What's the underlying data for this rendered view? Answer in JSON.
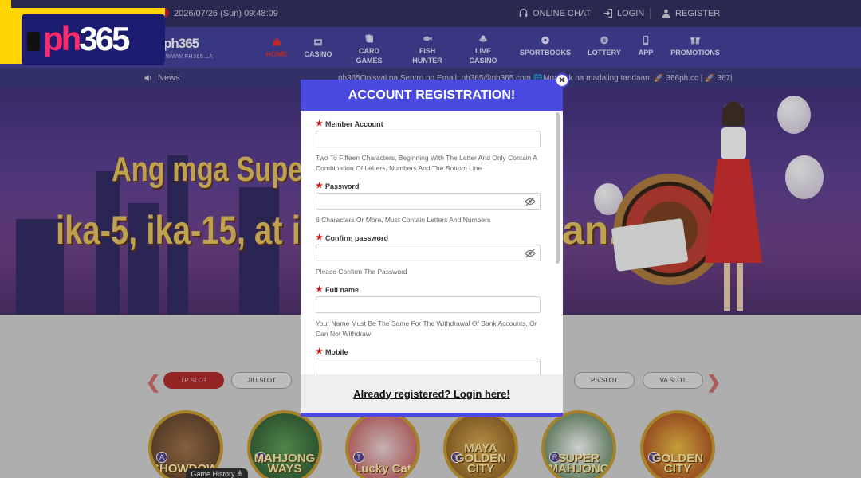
{
  "topbar": {
    "datetime": "2026/07/26 (Sun) 09:48:09",
    "online_chat": "ONLINE CHAT",
    "login": "LOGIN",
    "register": "REGISTER"
  },
  "brand": {
    "logo_text_a": "ph",
    "logo_text_b": "365",
    "small_logo": "ph365",
    "site_url": "WWW.PH365.LA"
  },
  "nav": {
    "items": [
      {
        "label": "HOME",
        "icon": "home-icon",
        "active": true
      },
      {
        "label": "CASINO",
        "icon": "casino-icon"
      },
      {
        "label": "CARD GAMES",
        "icon": "cards-icon"
      },
      {
        "label": "FISH HUNTER",
        "icon": "fish-icon"
      },
      {
        "label": "LIVE CASINO",
        "icon": "live-casino-icon"
      },
      {
        "label": "SPORTBOOKS",
        "icon": "soccer-ball-icon"
      },
      {
        "label": "LOTTERY",
        "icon": "lottery-ball-icon"
      },
      {
        "label": "APP",
        "icon": "phone-icon"
      },
      {
        "label": "PROMOTIONS",
        "icon": "gift-icon"
      }
    ]
  },
  "news": {
    "label": "News",
    "ticker": "ph365Opisyal na Sentro ng Email: ph365@ph365.com 🌐Mga link na madaling tandaan: 🚀 366ph.cc | 🚀 367ị"
  },
  "banner": {
    "line1": "Ang mga Super",
    "line2": "ika-5, ika-15, at ik",
    "line2_end": "an."
  },
  "modal": {
    "title": "ACCOUNT REGISTRATION!",
    "close": "×",
    "fields": [
      {
        "label": "Member Account",
        "hint": "Two To Fifteen Characters, Beginning With The Letter And Only Contain A Combination Of Letters, Numbers And The Bottom Line",
        "value": "",
        "has_eye": false
      },
      {
        "label": "Password",
        "hint": "6 Characters Or More, Must Contain Letters And Numbers",
        "value": "",
        "has_eye": true
      },
      {
        "label": "Confirm password",
        "hint": "Please Confirm The Password",
        "value": "",
        "has_eye": true
      },
      {
        "label": "Full name",
        "hint": "Your Name Must Be The Same For The Withdrawal Of Bank Accounts, Or Can Not Withdraw",
        "value": "",
        "has_eye": false
      },
      {
        "label": "Mobile",
        "hint": "",
        "value": "",
        "has_eye": false
      }
    ],
    "login_link": "Already registered? Login here!"
  },
  "slot_tabs": [
    "TP SLOT",
    "JILI SLOT",
    "PS SLOT",
    "VA SLOT"
  ],
  "games": [
    {
      "name": "SHOWDOWN",
      "badge": "A"
    },
    {
      "name": "MAHJONG WAYS",
      "badge": "A"
    },
    {
      "name": "Lucky Cat",
      "badge": "T"
    },
    {
      "name": "MAYA GOLDEN CITY",
      "badge": "Y"
    },
    {
      "name": "SUPER MAHJONG",
      "badge": "R"
    },
    {
      "name": "GOLDEN CITY",
      "badge": "Y"
    }
  ],
  "game_history": "Game History ≜",
  "colors": {
    "nav_bg": "#3d3d9b",
    "modal_accent": "#4a4ae0",
    "logo_yellow": "#ffd400",
    "logo_pink": "#ff2a6a",
    "active_red": "#e02a2a"
  }
}
